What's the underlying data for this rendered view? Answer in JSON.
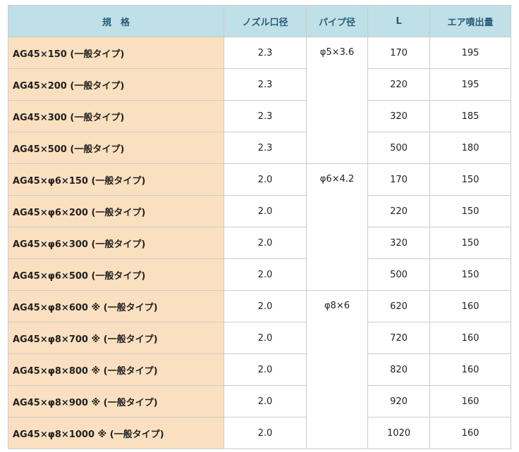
{
  "headers": {
    "spec": "規　格",
    "nozzle": "ノズル口径",
    "pipe": "パイプ径",
    "length": "L",
    "air": "エア噴出量"
  },
  "groups": [
    {
      "pipe": "φ5×3.6",
      "rows": [
        {
          "spec": "AG45×150 (一般タイプ)",
          "nozzle": "2.3",
          "length": "170",
          "air": "195"
        },
        {
          "spec": "AG45×200 (一般タイプ)",
          "nozzle": "2.3",
          "length": "220",
          "air": "195"
        },
        {
          "spec": "AG45×300 (一般タイプ)",
          "nozzle": "2.3",
          "length": "320",
          "air": "185"
        },
        {
          "spec": "AG45×500 (一般タイプ)",
          "nozzle": "2.3",
          "length": "500",
          "air": "180"
        }
      ]
    },
    {
      "pipe": "φ6×4.2",
      "rows": [
        {
          "spec": "AG45×φ6×150 (一般タイプ)",
          "nozzle": "2.0",
          "length": "170",
          "air": "150"
        },
        {
          "spec": "AG45×φ6×200 (一般タイプ)",
          "nozzle": "2.0",
          "length": "220",
          "air": "150"
        },
        {
          "spec": "AG45×φ6×300 (一般タイプ)",
          "nozzle": "2.0",
          "length": "320",
          "air": "150"
        },
        {
          "spec": "AG45×φ6×500 (一般タイプ)",
          "nozzle": "2.0",
          "length": "500",
          "air": "150"
        }
      ]
    },
    {
      "pipe": "φ8×6",
      "rows": [
        {
          "spec": "AG45×φ8×600 ※ (一般タイプ)",
          "nozzle": "2.0",
          "length": "620",
          "air": "160"
        },
        {
          "spec": "AG45×φ8×700 ※ (一般タイプ)",
          "nozzle": "2.0",
          "length": "720",
          "air": "160"
        },
        {
          "spec": "AG45×φ8×800 ※ (一般タイプ)",
          "nozzle": "2.0",
          "length": "820",
          "air": "160"
        },
        {
          "spec": "AG45×φ8×900 ※ (一般タイプ)",
          "nozzle": "2.0",
          "length": "920",
          "air": "160"
        },
        {
          "spec": "AG45×φ8×1000 ※ (一般タイプ)",
          "nozzle": "2.0",
          "length": "1020",
          "air": "160"
        }
      ]
    }
  ],
  "colors": {
    "header_bg": "#bfe0e6",
    "header_text": "#2a5f7a",
    "name_bg": "#fae0c0",
    "border": "#cccccc"
  }
}
